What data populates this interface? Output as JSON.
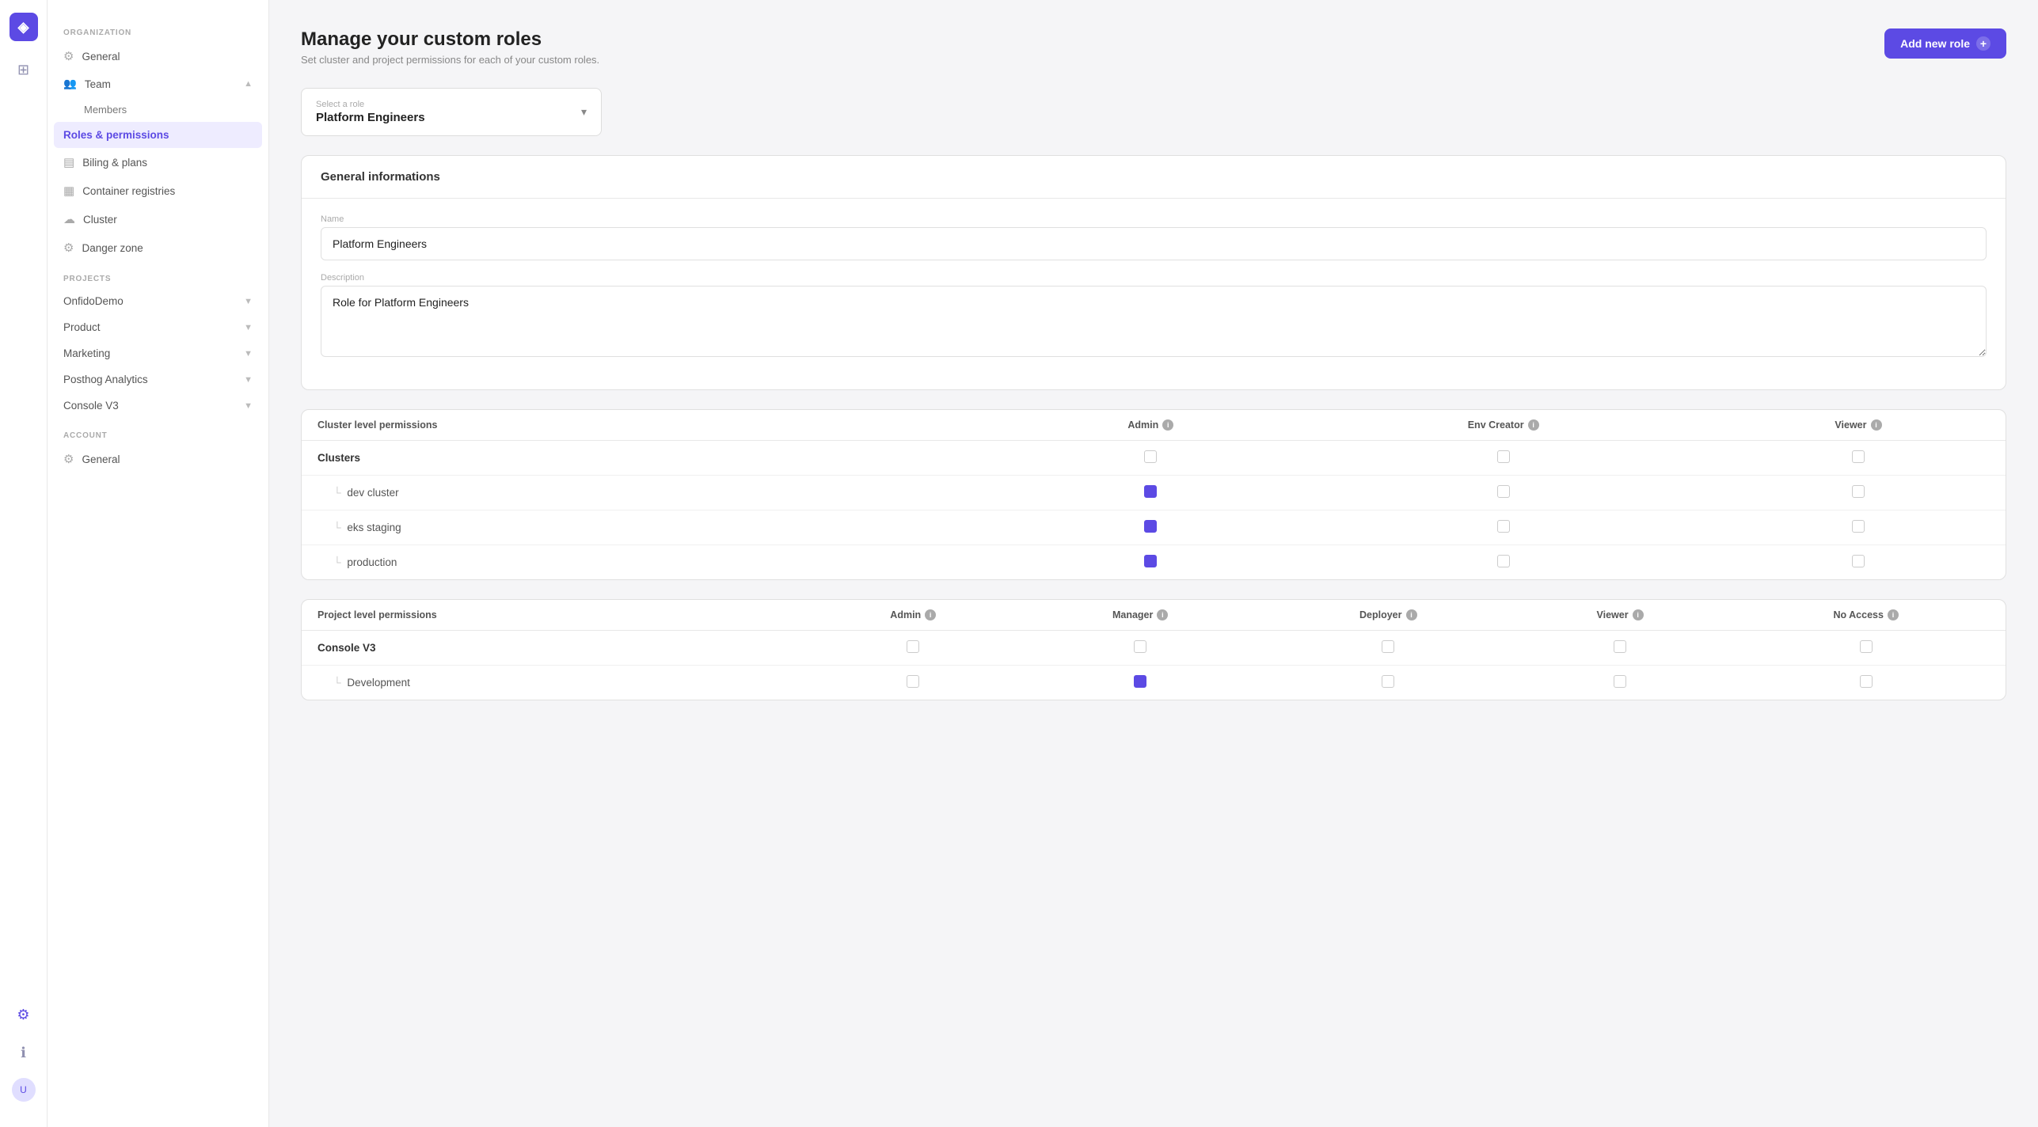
{
  "app": {
    "logo": "◈"
  },
  "page": {
    "title": "Manage your custom roles",
    "subtitle": "Set cluster and project permissions for each of your custom roles.",
    "add_button_label": "Add new role"
  },
  "role_select": {
    "label": "Select a role",
    "value": "Platform Engineers"
  },
  "general_info": {
    "section_title": "General informations",
    "name_label": "Name",
    "name_value": "Platform Engineers",
    "desc_label": "Description",
    "desc_value": "Role for Platform Engineers"
  },
  "cluster_permissions": {
    "section_title": "Cluster level permissions",
    "headers": [
      "Cluster level permissions",
      "Admin",
      "Env Creator",
      "Viewer"
    ],
    "rows": [
      {
        "name": "Clusters",
        "sub": false,
        "admin": false,
        "env_creator": false,
        "viewer": false
      },
      {
        "name": "dev cluster",
        "sub": true,
        "admin": true,
        "env_creator": false,
        "viewer": false
      },
      {
        "name": "eks staging",
        "sub": true,
        "admin": true,
        "env_creator": false,
        "viewer": false
      },
      {
        "name": "production",
        "sub": true,
        "admin": true,
        "env_creator": false,
        "viewer": false
      }
    ]
  },
  "project_permissions": {
    "section_title": "Project level permissions",
    "headers": [
      "Project level permissions",
      "Admin",
      "Manager",
      "Deployer",
      "Viewer",
      "No Access"
    ],
    "rows": [
      {
        "name": "Console V3",
        "sub": false,
        "admin": false,
        "manager": false,
        "deployer": false,
        "viewer": false,
        "no_access": false
      },
      {
        "name": "Development",
        "sub": true,
        "admin": false,
        "manager": true,
        "deployer": false,
        "viewer": false,
        "no_access": false
      }
    ]
  },
  "sidebar": {
    "org_label": "ORGANIZATION",
    "projects_label": "PROJECTS",
    "account_label": "ACCOUNT",
    "org_items": [
      {
        "id": "general",
        "label": "General",
        "icon": "⚙"
      },
      {
        "id": "team",
        "label": "Team",
        "icon": "👥",
        "expandable": true
      },
      {
        "id": "members",
        "label": "Members",
        "sub": true
      },
      {
        "id": "roles",
        "label": "Roles & permissions",
        "sub": true,
        "active": true
      },
      {
        "id": "billing",
        "label": "Biling & plans",
        "icon": "💳"
      },
      {
        "id": "container-registries",
        "label": "Container registries",
        "icon": "🗃"
      },
      {
        "id": "cluster",
        "label": "Cluster",
        "icon": "☁"
      },
      {
        "id": "danger",
        "label": "Danger zone",
        "icon": "⚠"
      }
    ],
    "project_items": [
      {
        "id": "onfidodemo",
        "label": "OnfidoDemo",
        "expandable": true
      },
      {
        "id": "product",
        "label": "Product",
        "expandable": true
      },
      {
        "id": "marketing",
        "label": "Marketing",
        "expandable": true
      },
      {
        "id": "posthog",
        "label": "Posthog Analytics",
        "expandable": true
      },
      {
        "id": "consolev3",
        "label": "Console V3",
        "expandable": true
      }
    ],
    "account_items": [
      {
        "id": "acc-general",
        "label": "General",
        "icon": "⚙"
      }
    ]
  }
}
